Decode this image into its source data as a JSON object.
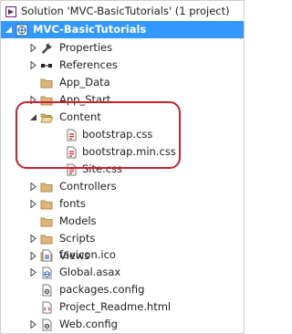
{
  "solution_explorer": {
    "solution_label": "Solution 'MVC-BasicTutorials' (1 project)",
    "project_label": "MVC-BasicTutorials",
    "items": [
      {
        "label": "Properties",
        "icon": "wrench-icon"
      },
      {
        "label": "References",
        "icon": "references-icon"
      },
      {
        "label": "App_Data",
        "icon": "folder-icon"
      },
      {
        "label": "App_Start",
        "icon": "folder-icon"
      },
      {
        "label": "Content",
        "icon": "folder-open-icon"
      },
      {
        "label": "bootstrap.css",
        "icon": "css-file-icon"
      },
      {
        "label": "bootstrap.min.css",
        "icon": "css-file-icon"
      },
      {
        "label": "Site.css",
        "icon": "css-file-icon"
      },
      {
        "label": "Controllers",
        "icon": "folder-icon"
      },
      {
        "label": "fonts",
        "icon": "folder-icon"
      },
      {
        "label": "Models",
        "icon": "folder-icon"
      },
      {
        "label": "Scripts",
        "icon": "folder-icon"
      },
      {
        "label": "Views",
        "icon": "folder-icon"
      },
      {
        "label": "favicon.ico",
        "icon": "ico-file-icon"
      },
      {
        "label": "Global.asax",
        "icon": "asax-file-icon"
      },
      {
        "label": "packages.config",
        "icon": "config-file-icon"
      },
      {
        "label": "Project_Readme.html",
        "icon": "html-file-icon"
      },
      {
        "label": "Web.config",
        "icon": "config-file-icon"
      }
    ]
  },
  "colors": {
    "selection": "#3399ff",
    "folder": "#dcb67a",
    "highlight_ring": "#cc1f2f"
  }
}
